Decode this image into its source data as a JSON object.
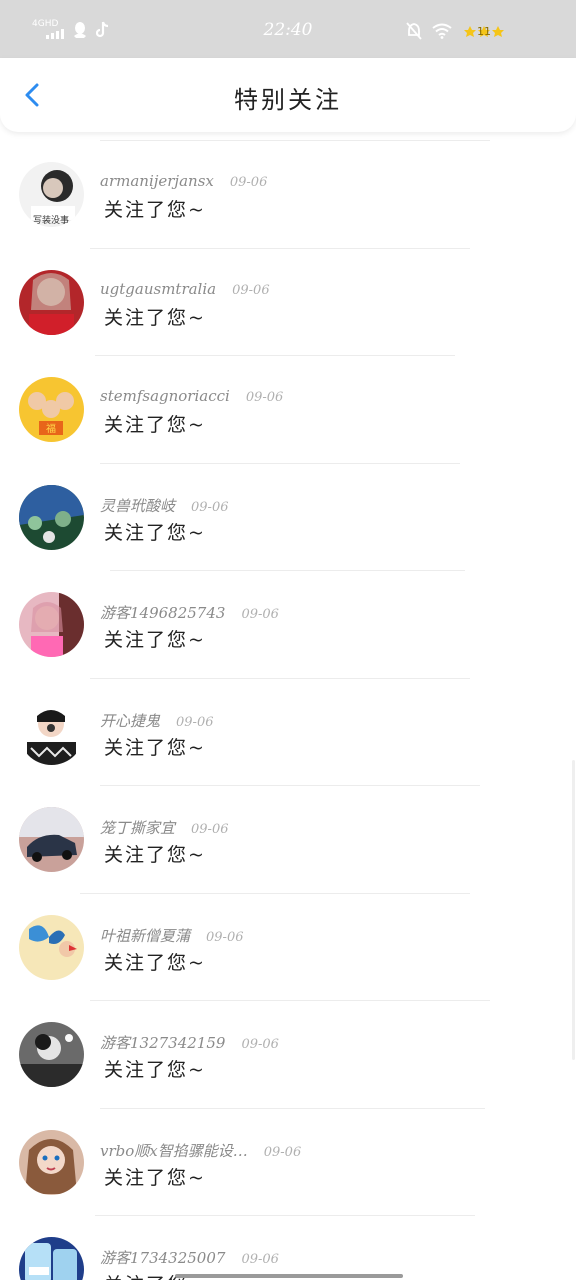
{
  "status_bar": {
    "network": "4GHD",
    "time": "22:40",
    "battery": "11",
    "battery_level": 0.11,
    "icons": [
      "signal-icon",
      "qq-icon",
      "tiktok-icon",
      "mute-icon",
      "wifi-icon",
      "battery-icon"
    ]
  },
  "header": {
    "title": "特别关注",
    "back_icon": "chevron-left-icon"
  },
  "colors": {
    "accent": "#2d8cf0",
    "status_bar_bg": "#d9d9d9",
    "battery": "#f5c518"
  },
  "notifications": [
    {
      "username": "armanijerjansx",
      "date": "09-06",
      "action": "关注了您~",
      "avatar_caption": "写装没事"
    },
    {
      "username": "ugtgausmtralia",
      "date": "09-06",
      "action": "关注了您~"
    },
    {
      "username": "stemfsagnoriacci",
      "date": "09-06",
      "action": "关注了您~",
      "avatar_caption": "福"
    },
    {
      "username": "灵兽玳酸岐",
      "date": "09-06",
      "action": "关注了您~"
    },
    {
      "username": "游客1496825743",
      "date": "09-06",
      "action": "关注了您~"
    },
    {
      "username": "开心捷鬼",
      "date": "09-06",
      "action": "关注了您~"
    },
    {
      "username": "笼丁撕家宜",
      "date": "09-06",
      "action": "关注了您~"
    },
    {
      "username": "叶祖新僧夏蒲",
      "date": "09-06",
      "action": "关注了您~"
    },
    {
      "username": "游客1327342159",
      "date": "09-06",
      "action": "关注了您~"
    },
    {
      "username": "vrbo顺x智掐骡能设…",
      "date": "09-06",
      "action": "关注了您~"
    },
    {
      "username": "游客1734325007",
      "date": "09-06",
      "action": "关注了您~"
    }
  ]
}
